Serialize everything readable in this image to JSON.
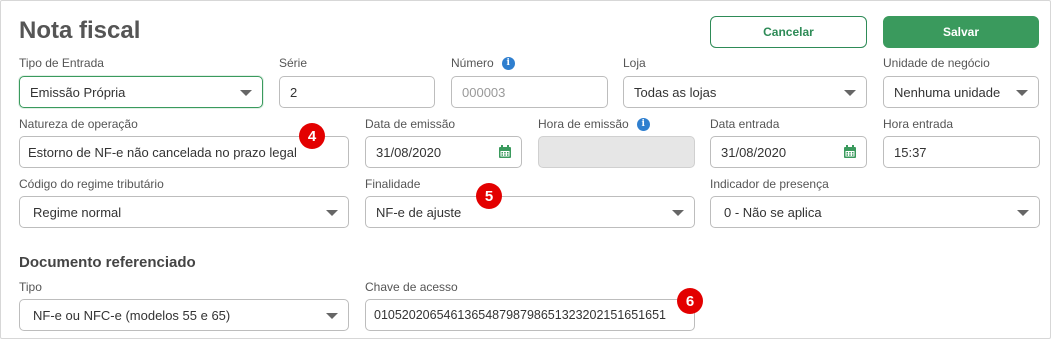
{
  "page": {
    "title": "Nota fiscal"
  },
  "actions": {
    "cancel_label": "Cancelar",
    "save_label": "Salvar"
  },
  "row1": {
    "tipo_entrada": {
      "label": "Tipo de Entrada",
      "value": "Emissão Própria"
    },
    "serie": {
      "label": "Série",
      "value": "2"
    },
    "numero": {
      "label": "Número",
      "placeholder": "000003"
    },
    "loja": {
      "label": "Loja",
      "value": "Todas as lojas"
    },
    "unidade": {
      "label": "Unidade de negócio",
      "value": "Nenhuma unidade"
    }
  },
  "row2": {
    "natureza": {
      "label": "Natureza de operação",
      "value": "Estorno de NF-e não cancelada no prazo legal"
    },
    "data_emissao": {
      "label": "Data de emissão",
      "value": "31/08/2020"
    },
    "hora_emissao": {
      "label": "Hora de emissão",
      "value": ""
    },
    "data_entrada": {
      "label": "Data entrada",
      "value": "31/08/2020"
    },
    "hora_entrada": {
      "label": "Hora entrada",
      "value": "15:37"
    }
  },
  "row3": {
    "regime": {
      "label": "Código do regime tributário",
      "value": "Regime normal"
    },
    "finalidade": {
      "label": "Finalidade",
      "value": "NF-e de ajuste"
    },
    "presenca": {
      "label": "Indicador de presença",
      "value": "0 - Não se aplica"
    }
  },
  "documento": {
    "heading": "Documento referenciado",
    "tipo": {
      "label": "Tipo",
      "value": "NF-e ou NFC-e (modelos 55 e 65)"
    },
    "chave": {
      "label": "Chave de acesso",
      "value": "01052020654613654879879865132320215165165​1"
    }
  },
  "markers": {
    "m4": "4",
    "m5": "5",
    "m6": "6"
  },
  "colors": {
    "accent": "#3a9a5d",
    "info": "#2f7fcf",
    "marker": "#e30000"
  },
  "icons": {
    "calendar": "calendar-icon",
    "info": "info-icon",
    "dropdown": "chevron-down-icon"
  }
}
